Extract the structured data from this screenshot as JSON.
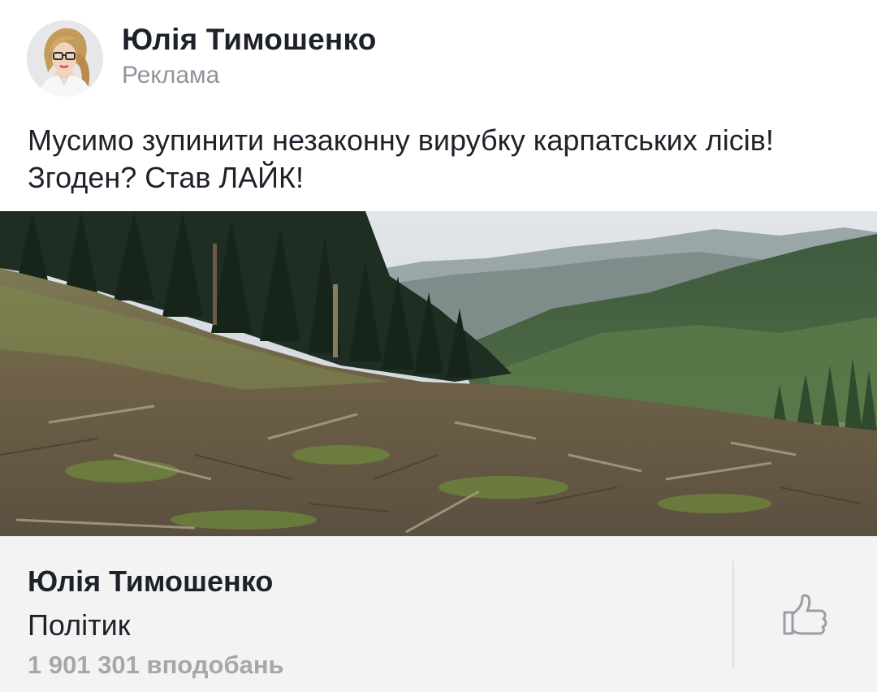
{
  "post": {
    "author": "Юлія Тимошенко",
    "sponsored_label": "Реклама",
    "message": "Мусимо зупинити незаконну вирубку карпатських лісів! Згоден? Став ЛАЙК!"
  },
  "page_card": {
    "name": "Юлія Тимошенко",
    "category": "Політик",
    "likes": "1 901 301 вподобань"
  },
  "icons": {
    "like": "thumbs-up-icon",
    "avatar": "profile-photo"
  },
  "colors": {
    "text_primary": "#1d2129",
    "text_secondary": "#90949c",
    "likes_text": "#a5a7ab",
    "footer_bg": "#f3f3f4"
  }
}
